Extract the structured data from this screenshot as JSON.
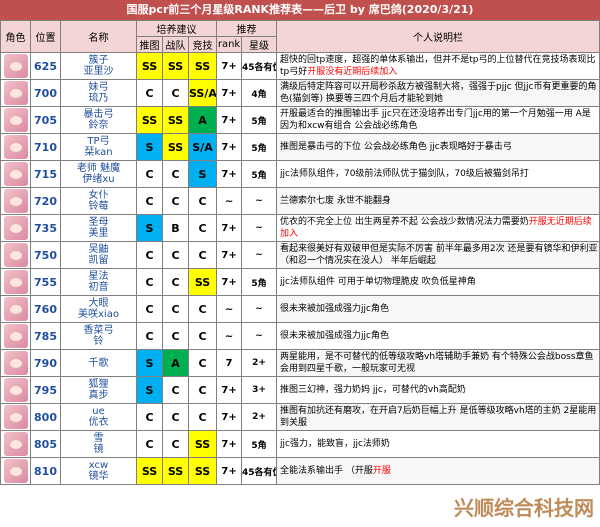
{
  "title": "国服pcr前三个月星级RANK推荐表——后卫  by  席巴鸽(2020/3/21)",
  "headers": {
    "role": "角色",
    "pos": "位置",
    "name": "名称",
    "build_group": "培养建议",
    "recommend_group": "推荐",
    "push": "推图",
    "clan": "战队",
    "arena": "竞技",
    "rank": "rank",
    "star": "星级",
    "note": "个人说明栏"
  },
  "rows": [
    {
      "pos": "625",
      "name": "簇子\n亚里沙",
      "push": "SS",
      "clan": "SS",
      "arena": "SS",
      "rank": "7+",
      "star": "45各有优势",
      "desc": "超快的回tp速度，超强的单体系输出，但并不是tp弓的上位替代在竞技场表现比tp弓好",
      "red": "开服没有近期后续加入"
    },
    {
      "pos": "700",
      "name": "妹弓\n琉乃",
      "push": "C",
      "clan": "C",
      "arena": "SS/A",
      "rank": "7+",
      "star": "4角",
      "desc": "满级后特定阵容可以开局秒杀敌方被强制大将，强强于pjjc 但jjc币有更重要的角色(猫剑等) 换要等三四个月后才能轮到她",
      "red": ""
    },
    {
      "pos": "705",
      "name": "暴击弓\n鈴奈",
      "push": "SS",
      "clan": "SS",
      "arena": "A",
      "rank": "7+",
      "star": "5角",
      "desc": "开服最适合的推图输出手 jjc只在还没培养出专门jjc用的第一个月勉强一用  A是因为和xcw有组合  公会战必练角色",
      "red": ""
    },
    {
      "pos": "710",
      "name": "TP弓\n栞kan",
      "push": "S",
      "clan": "SS",
      "arena": "S/A",
      "rank": "7+",
      "star": "5角",
      "desc": "推图是暴击弓的下位  公会战必练角色  jjc表现略好于暴击弓",
      "red": ""
    },
    {
      "pos": "715",
      "name": "老师 魅魔\n伊绪xu",
      "push": "C",
      "clan": "C",
      "arena": "S",
      "rank": "7+",
      "star": "5角",
      "desc": "jjc法师队组件，70级前法师队优于猫剑队，70级后被猫剑吊打",
      "red": ""
    },
    {
      "pos": "720",
      "name": "女仆\n铃莓",
      "push": "C",
      "clan": "C",
      "arena": "C",
      "rank": "~",
      "star": "~",
      "desc": "兰德索尔七废  永世不能翻身",
      "red": ""
    },
    {
      "pos": "735",
      "name": "圣母\n美里",
      "push": "S",
      "clan": "B",
      "arena": "C",
      "rank": "7+",
      "star": "~",
      "desc": "优衣的不完全上位  出生两星养不起 公会战少数情况法力需要奶",
      "red": "开服无近期后续加入"
    },
    {
      "pos": "750",
      "name": "吴鼬\n凯留",
      "push": "C",
      "clan": "C",
      "arena": "C",
      "rank": "7+",
      "star": "~",
      "desc": "看起来很美好有双破甲但是实际不厉害    前半年最多用2次 还是要有镜华和伊利亚（和忍一个情况实在没人）  半年后崛起",
      "red": ""
    },
    {
      "pos": "755",
      "name": "星法\n初音",
      "push": "C",
      "clan": "C",
      "arena": "SS",
      "rank": "7+",
      "star": "5角",
      "desc": "jjc法师队组件  可用于单切物理脆皮  吹负低星神角",
      "red": ""
    },
    {
      "pos": "760",
      "name": "大眼\n美咲xiao",
      "push": "C",
      "clan": "C",
      "arena": "C",
      "rank": "~",
      "star": "~",
      "desc": "很未来被加强成强力jjc角色",
      "red": ""
    },
    {
      "pos": "785",
      "name": "香菜弓\n铃",
      "push": "C",
      "clan": "C",
      "arena": "C",
      "rank": "~",
      "star": "~",
      "desc": "很未来被加强成强力jjc角色",
      "red": ""
    },
    {
      "pos": "790",
      "name": "千歌",
      "push": "S",
      "clan": "A",
      "arena": "C",
      "rank": "7",
      "star": "2+",
      "desc": "两星能用，是不可替代的低等级攻略vh塔辅助手兼奶 有个特殊公会战boss章鱼会用到四星千歌，一般玩家可无视",
      "red": ""
    },
    {
      "pos": "795",
      "name": "狐狸\n真步",
      "push": "S",
      "clan": "C",
      "arena": "C",
      "rank": "7+",
      "star": "3+",
      "desc": "推图三幻神，强力奶妈 jjc，可替代的vh高配奶",
      "red": ""
    },
    {
      "pos": "800",
      "name": "ue\n优衣",
      "push": "C",
      "clan": "C",
      "arena": "C",
      "rank": "7+",
      "star": "2+",
      "desc": "推图有加抗还有磨攻，在开启7后奶巨幅上升 是低等级攻略vh塔的主奶  2星能用到关服",
      "red": ""
    },
    {
      "pos": "805",
      "name": "雪\n镜",
      "push": "C",
      "clan": "C",
      "arena": "SS",
      "rank": "7+",
      "star": "5角",
      "desc": "jjc强力，能致盲，jjc法师奶",
      "red": ""
    },
    {
      "pos": "810",
      "name": "xcw\n镜华",
      "push": "SS",
      "clan": "SS",
      "arena": "SS",
      "rank": "7+",
      "star": "45各有优势",
      "desc": "全能法系输出手  （开服",
      "red": "开服"
    }
  ],
  "watermark": "兴顺综合科技网"
}
